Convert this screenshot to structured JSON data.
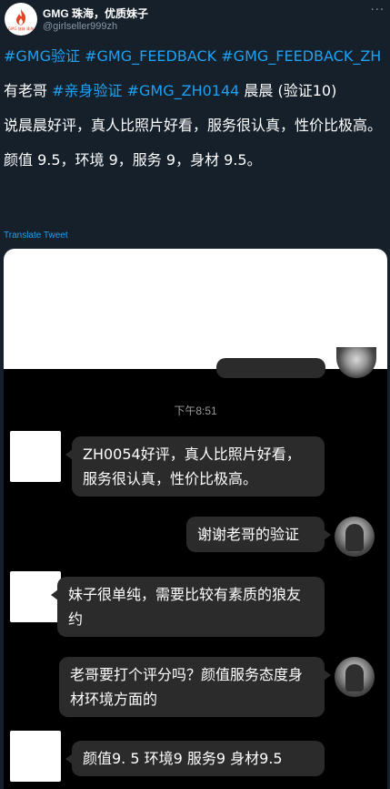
{
  "header": {
    "display_name": "GMG 珠海，优质妹子",
    "handle": "@girlseller999zh",
    "avatar_text": "GMG 妹妹\n珠海",
    "more_icon": "···"
  },
  "tweet": {
    "hashtags_line": [
      "#GMG验证",
      "#GMG_FEEDBACK",
      "#GMG_FEEDBACK_ZH"
    ],
    "line2_prefix": "有老哥 ",
    "line2_tag1": "#亲身验证",
    "line2_tag2": "#GMG_ZH0144",
    "line2_suffix": " 晨晨 (验证10)",
    "line3": "说晨晨好评，真人比照片好看，服务很认真，性价比极高。",
    "line4": "颜值 9.5，环境 9，服务 9，身材 9.5。",
    "translate_label": "Translate Tweet"
  },
  "chat": {
    "timestamp": "下午8:51",
    "messages": [
      {
        "side": "left",
        "text": "ZH0054好评，真人比照片好看，服务很认真，性价比极高。"
      },
      {
        "side": "right",
        "text": "谢谢老哥的验证"
      },
      {
        "side": "left",
        "text": "妹子很单纯，需要比较有素质的狼友约"
      },
      {
        "side": "right",
        "text": "老哥要打个评分吗？颜值服务态度身材环境方面的"
      },
      {
        "side": "left",
        "text": "颜值9. 5 环境9 服务9 身材9.5"
      }
    ]
  },
  "colors": {
    "background": "#15202b",
    "hashtag": "#1da1f2",
    "bubble": "#2b2b2b",
    "muted": "#8899a6"
  }
}
